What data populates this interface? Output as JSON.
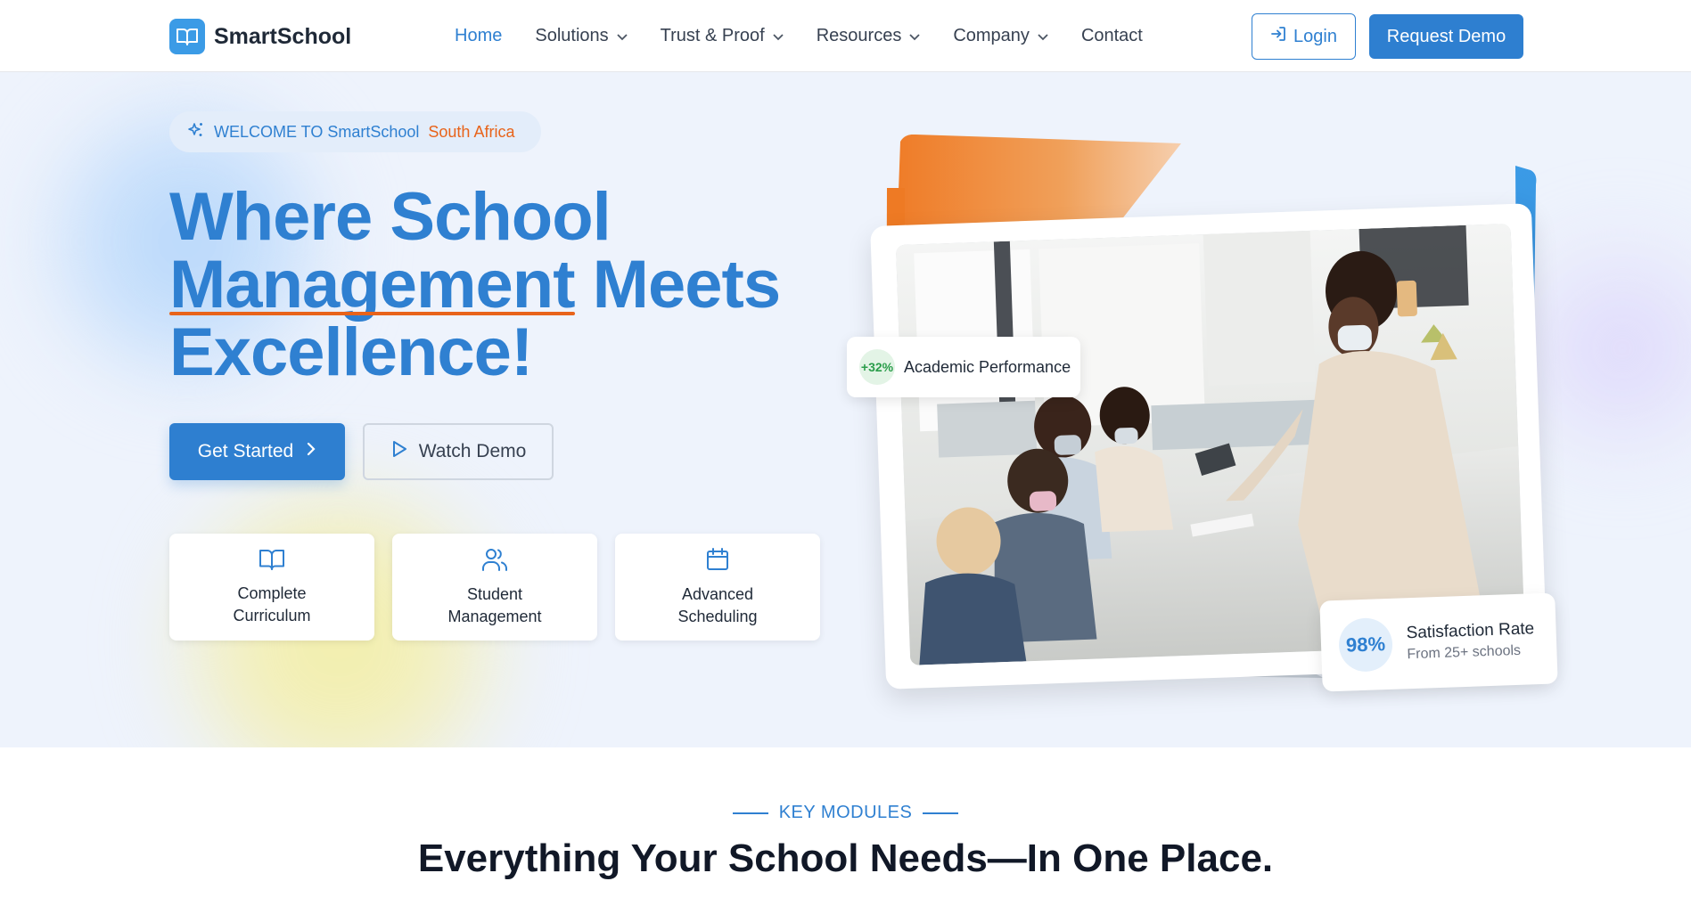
{
  "brand": {
    "name": "SmartSchool",
    "logo_icon": "open-book-icon"
  },
  "nav": {
    "items": [
      {
        "label": "Home",
        "active": true,
        "dropdown": false
      },
      {
        "label": "Solutions",
        "active": false,
        "dropdown": true
      },
      {
        "label": "Trust & Proof",
        "active": false,
        "dropdown": true
      },
      {
        "label": "Resources",
        "active": false,
        "dropdown": true
      },
      {
        "label": "Company",
        "active": false,
        "dropdown": true
      },
      {
        "label": "Contact",
        "active": false,
        "dropdown": false
      }
    ],
    "login_label": "Login",
    "demo_label": "Request Demo"
  },
  "hero": {
    "welcome_text": "WELCOME TO SmartSchool",
    "welcome_region": "South Africa",
    "headline_line1": "Where School",
    "headline_underlined": "Management",
    "headline_line2_rest": "Meets",
    "headline_line3": "Excellence!",
    "get_started_label": "Get Started",
    "watch_demo_label": "Watch Demo",
    "features": [
      {
        "label": "Complete Curriculum",
        "icon": "book-icon"
      },
      {
        "label": "Student Management",
        "icon": "users-icon"
      },
      {
        "label": "Advanced Scheduling",
        "icon": "calendar-icon"
      }
    ],
    "stat_academic": {
      "value": "+32%",
      "label": "Academic Performance"
    },
    "stat_satisfaction": {
      "value": "98%",
      "label": "Satisfaction Rate",
      "sub": "From 25+ schools"
    }
  },
  "section": {
    "kicker": "KEY MODULES",
    "title": "Everything Your School Needs—In One Place."
  },
  "colors": {
    "primary": "#2e7fd0",
    "accent_orange": "#e8631a",
    "hero_bg": "#eef3fc",
    "success": "#2a9d4a"
  }
}
